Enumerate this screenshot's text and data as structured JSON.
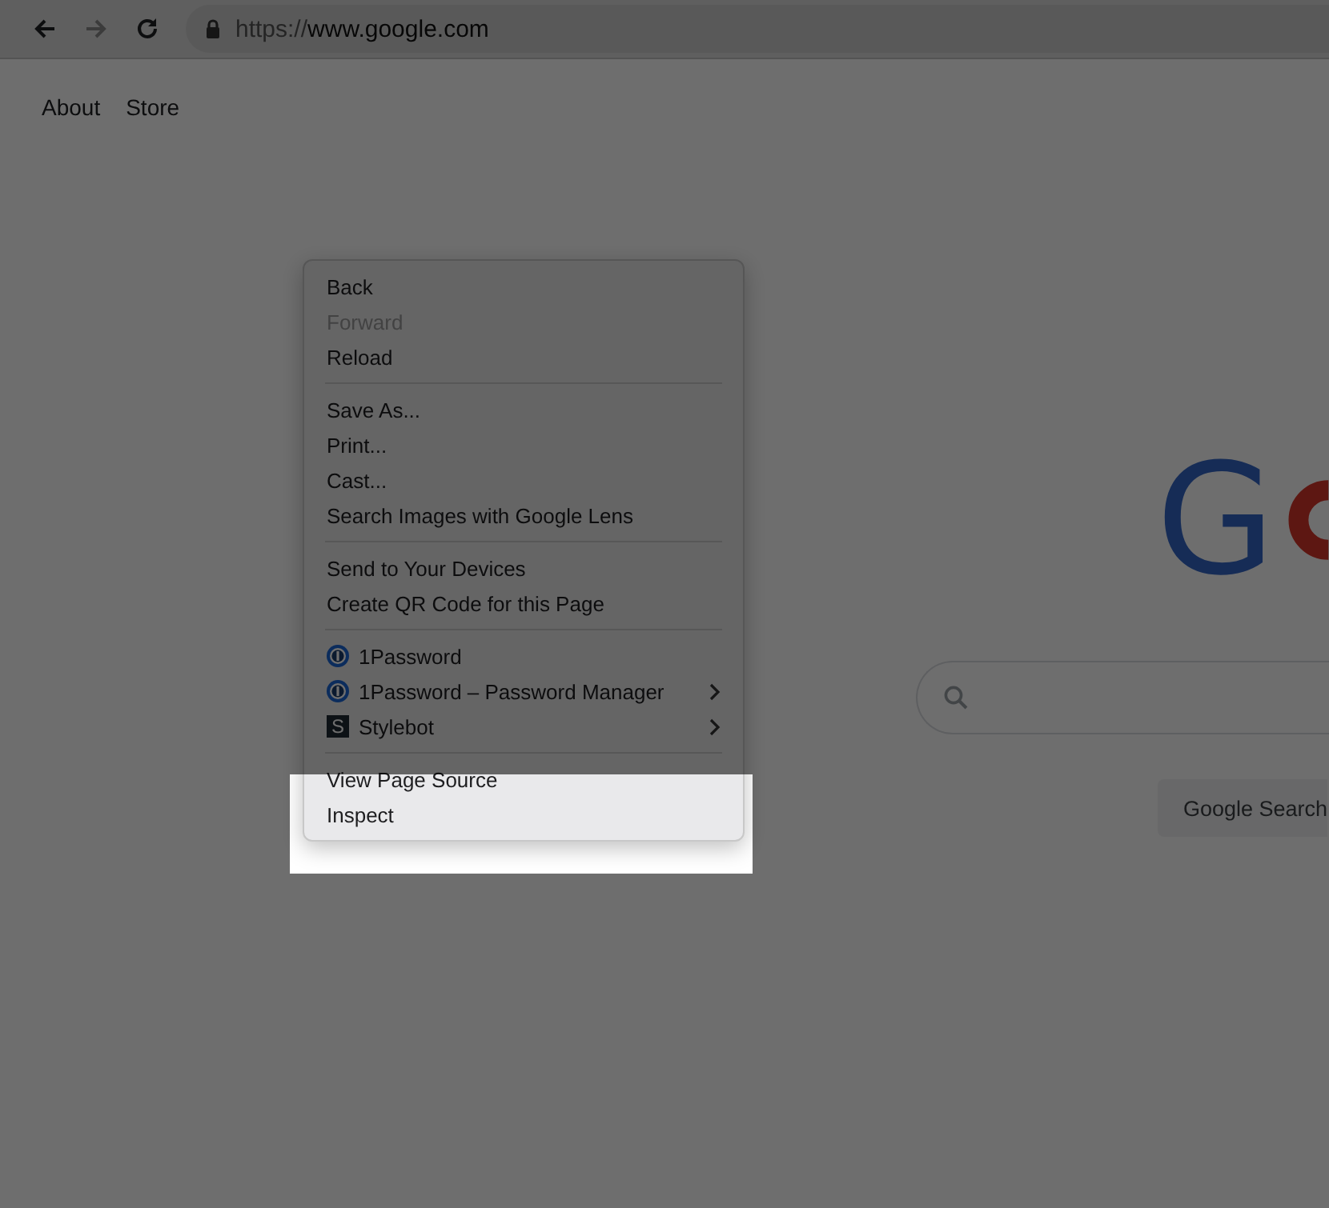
{
  "toolbar": {
    "nav_buttons": [
      {
        "kind": "back",
        "disabled": false
      },
      {
        "kind": "forward",
        "disabled": true
      },
      {
        "kind": "reload",
        "disabled": false
      }
    ],
    "address": {
      "scheme": "https://",
      "host": "www.google.com"
    }
  },
  "header_links": [
    "About",
    "Store"
  ],
  "logo_letter": "G",
  "search_button": "Google Search",
  "context_menu": {
    "sections": [
      {
        "items": [
          {
            "label": "Back",
            "disabled": false
          },
          {
            "label": "Forward",
            "disabled": true
          },
          {
            "label": "Reload",
            "disabled": false
          }
        ]
      },
      {
        "items": [
          {
            "label": "Save As...",
            "disabled": false
          },
          {
            "label": "Print...",
            "disabled": false
          },
          {
            "label": "Cast...",
            "disabled": false
          },
          {
            "label": "Search Images with Google Lens",
            "disabled": false
          }
        ]
      },
      {
        "items": [
          {
            "label": "Send to Your Devices",
            "disabled": false
          },
          {
            "label": "Create QR Code for this Page",
            "disabled": false
          }
        ]
      },
      {
        "items": [
          {
            "label": "1Password",
            "disabled": false,
            "kind": "round",
            "submenu": false
          },
          {
            "label": "1Password – Password Manager",
            "disabled": false,
            "kind": "round",
            "submenu": true
          },
          {
            "label": "Stylebot",
            "disabled": false,
            "kind": "badge",
            "badge_text": "S",
            "submenu": true
          }
        ]
      },
      {
        "highlighted": true,
        "items": [
          {
            "label": "View Page Source",
            "disabled": false
          },
          {
            "label": "Inspect",
            "disabled": false
          }
        ]
      }
    ]
  }
}
